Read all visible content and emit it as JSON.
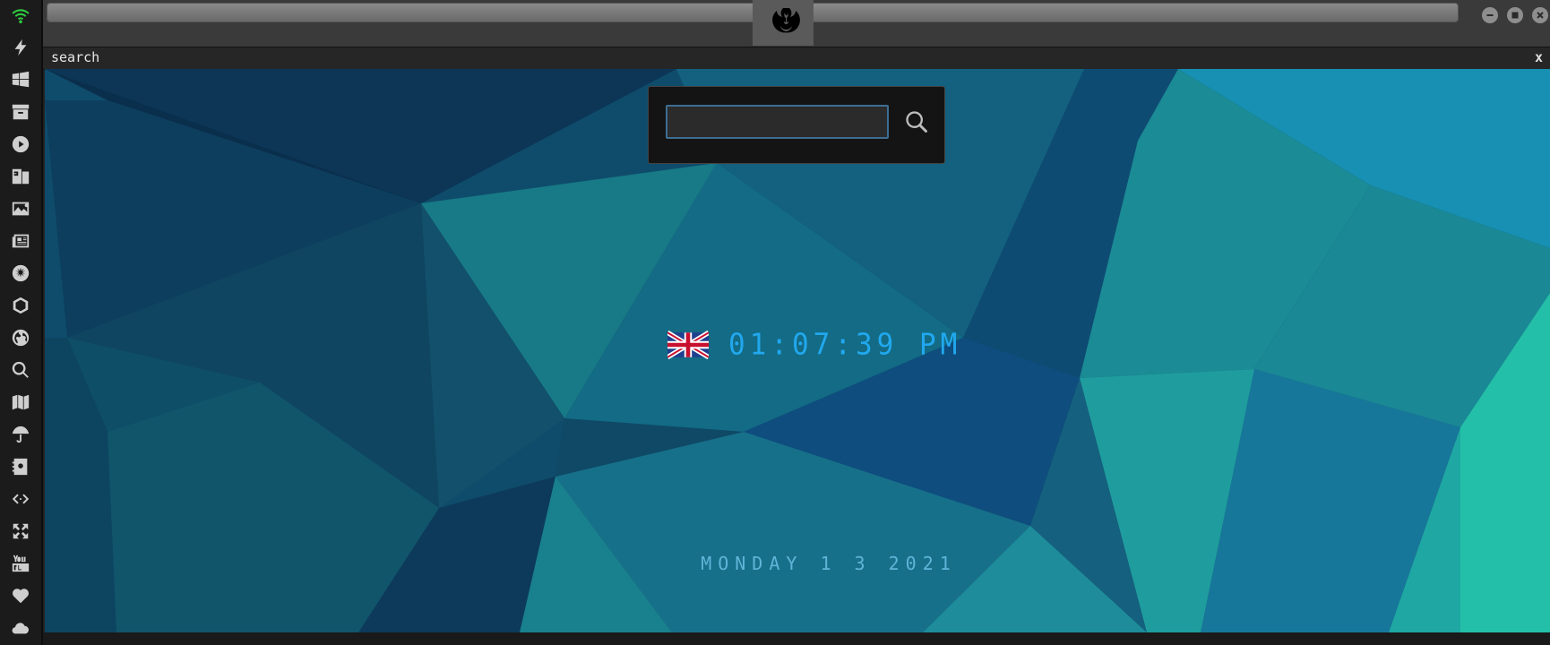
{
  "sidebar": {
    "items": [
      {
        "icon": "wifi-icon"
      },
      {
        "icon": "lightning-icon"
      },
      {
        "icon": "windows-icon"
      },
      {
        "icon": "archive-icon"
      },
      {
        "icon": "play-icon"
      },
      {
        "icon": "translate-icon"
      },
      {
        "icon": "image-icon"
      },
      {
        "icon": "news-icon"
      },
      {
        "icon": "galactic-empire-icon"
      },
      {
        "icon": "hexagon-icon"
      },
      {
        "icon": "globe-icon"
      },
      {
        "icon": "search-icon"
      },
      {
        "icon": "map-icon"
      },
      {
        "icon": "umbrella-icon"
      },
      {
        "icon": "contacts-icon"
      },
      {
        "icon": "code-icon"
      },
      {
        "icon": "expand-icon"
      },
      {
        "icon": "youtube-icon"
      },
      {
        "icon": "heart-icon"
      },
      {
        "icon": "cloud-icon"
      }
    ],
    "accent": "#2ecc40"
  },
  "topbar": {
    "logo_icon": "rebel-alliance-icon",
    "window_buttons": [
      "minimize-icon",
      "maximize-icon",
      "close-icon"
    ]
  },
  "tab": {
    "title": "search",
    "close_label": "x"
  },
  "search": {
    "value": "",
    "placeholder": "",
    "button_icon": "search-icon"
  },
  "clock": {
    "flag_icon": "uk-flag-icon",
    "time": "01:07:39 PM",
    "color": "#21a8ee"
  },
  "date": {
    "text": "MONDAY 1 3 2021"
  }
}
